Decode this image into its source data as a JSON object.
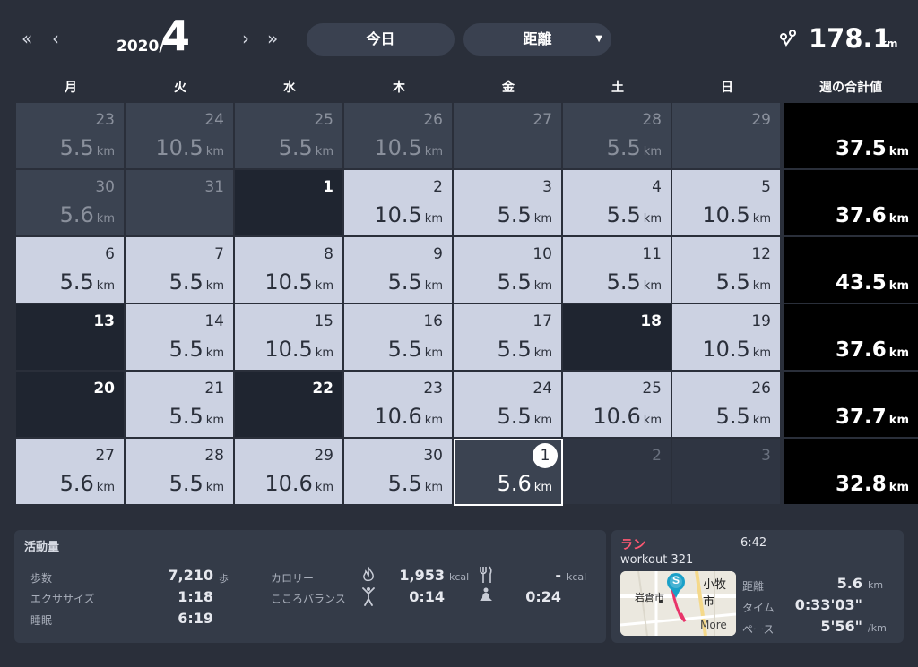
{
  "header": {
    "year": "2020/",
    "month": "4",
    "today_label": "今日",
    "metric_label": "距離",
    "total_value": "178.1",
    "total_unit": "km"
  },
  "weekdays": [
    "月",
    "火",
    "水",
    "木",
    "金",
    "土",
    "日",
    "週の合計値"
  ],
  "unit": "km",
  "weeks": [
    {
      "days": [
        {
          "date": "23",
          "value": "5.5"
        },
        {
          "date": "24",
          "value": "10.5"
        },
        {
          "date": "25",
          "value": "5.5"
        },
        {
          "date": "26",
          "value": "10.5"
        },
        {
          "date": "27",
          "value": ""
        },
        {
          "date": "28",
          "value": "5.5"
        },
        {
          "date": "29",
          "value": ""
        }
      ],
      "total": "37.5"
    },
    {
      "days": [
        {
          "date": "30",
          "value": "5.6"
        },
        {
          "date": "31",
          "value": ""
        },
        {
          "date": "1",
          "value": ""
        },
        {
          "date": "2",
          "value": "10.5"
        },
        {
          "date": "3",
          "value": "5.5"
        },
        {
          "date": "4",
          "value": "5.5"
        },
        {
          "date": "5",
          "value": "10.5"
        }
      ],
      "total": "37.6"
    },
    {
      "days": [
        {
          "date": "6",
          "value": "5.5"
        },
        {
          "date": "7",
          "value": "5.5"
        },
        {
          "date": "8",
          "value": "10.5"
        },
        {
          "date": "9",
          "value": "5.5"
        },
        {
          "date": "10",
          "value": "5.5"
        },
        {
          "date": "11",
          "value": "5.5"
        },
        {
          "date": "12",
          "value": "5.5"
        }
      ],
      "total": "43.5"
    },
    {
      "days": [
        {
          "date": "13",
          "value": ""
        },
        {
          "date": "14",
          "value": "5.5"
        },
        {
          "date": "15",
          "value": "10.5"
        },
        {
          "date": "16",
          "value": "5.5"
        },
        {
          "date": "17",
          "value": "5.5"
        },
        {
          "date": "18",
          "value": ""
        },
        {
          "date": "19",
          "value": "10.5"
        }
      ],
      "total": "37.6"
    },
    {
      "days": [
        {
          "date": "20",
          "value": ""
        },
        {
          "date": "21",
          "value": "5.5"
        },
        {
          "date": "22",
          "value": ""
        },
        {
          "date": "23",
          "value": "10.6"
        },
        {
          "date": "24",
          "value": "5.5"
        },
        {
          "date": "25",
          "value": "10.6"
        },
        {
          "date": "26",
          "value": "5.5"
        }
      ],
      "total": "37.7"
    },
    {
      "days": [
        {
          "date": "27",
          "value": "5.6"
        },
        {
          "date": "28",
          "value": "5.5"
        },
        {
          "date": "29",
          "value": "10.6"
        },
        {
          "date": "30",
          "value": "5.5"
        },
        {
          "date": "1",
          "value": "5.6"
        },
        {
          "date": "2",
          "value": ""
        },
        {
          "date": "3",
          "value": ""
        }
      ],
      "total": "32.8"
    }
  ],
  "activity": {
    "title": "活動量",
    "steps_label": "歩数",
    "steps_value": "7,210",
    "steps_unit": "歩",
    "exercise_label": "エクササイズ",
    "exercise_value": "1:18",
    "sleep_label": "睡眠",
    "sleep_value": "6:19",
    "calorie_label": "カロリー",
    "calorie_value": "1,953",
    "calorie_unit": "kcal",
    "intake_value": "-",
    "intake_unit": "kcal",
    "mind_label": "こころバランス",
    "mind_value": "0:14",
    "meditation_value": "0:24"
  },
  "workout": {
    "type": "ラン",
    "time": "6:42",
    "name": "workout 321",
    "map_city1": "岩倉市",
    "map_city2": "小牧市",
    "map_more": "More",
    "distance_label": "距離",
    "distance_value": "5.6",
    "distance_unit": "km",
    "duration_label": "タイム",
    "duration_value": "0:33'03\"",
    "pace_label": "ペース",
    "pace_value": "5'56\"",
    "pace_unit": "/km"
  }
}
